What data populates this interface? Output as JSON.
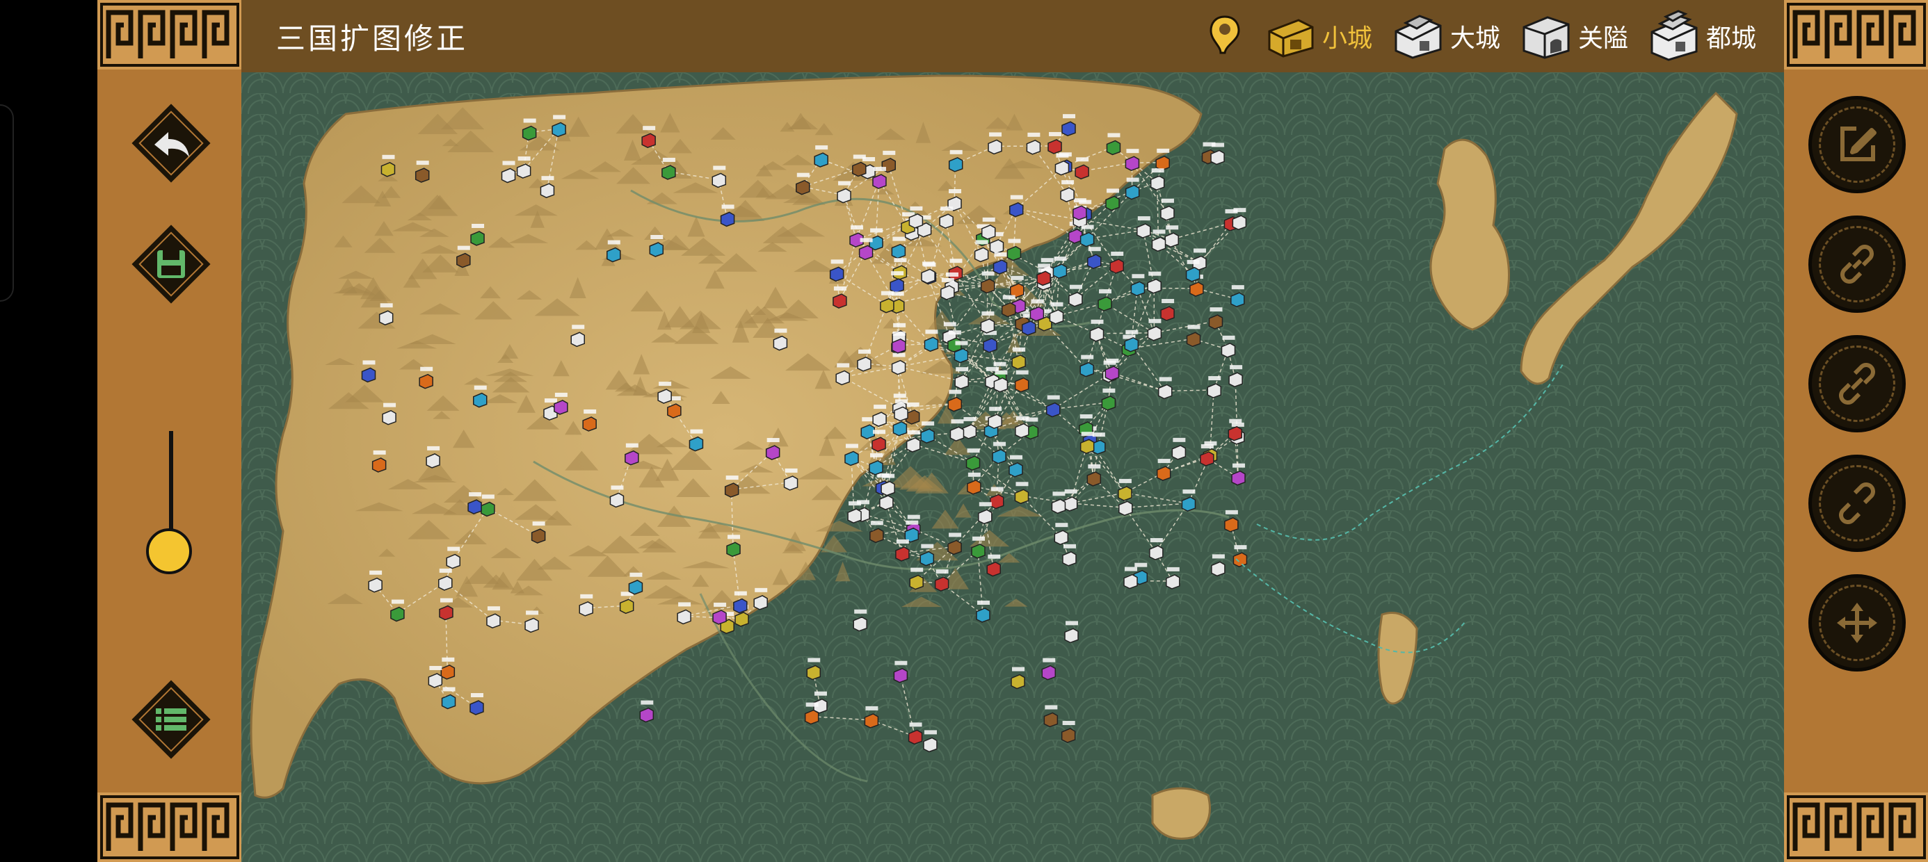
{
  "app": {
    "title": "三国扩图修正"
  },
  "legend": {
    "marker_icon": "map-pin-icon",
    "items": [
      {
        "label": "小城",
        "icon": "small-city-icon",
        "selected": true
      },
      {
        "label": "大城",
        "icon": "large-city-icon",
        "selected": false
      },
      {
        "label": "关隘",
        "icon": "pass-icon",
        "selected": false
      },
      {
        "label": "都城",
        "icon": "capital-icon",
        "selected": false
      }
    ]
  },
  "left_toolbar": {
    "buttons": [
      {
        "name": "back-button",
        "icon": "back-arrow-icon"
      },
      {
        "name": "save-button",
        "icon": "floppy-disk-icon"
      },
      {
        "name": "list-button",
        "icon": "list-icon"
      }
    ],
    "zoom_level": 0.15
  },
  "right_toolbar": {
    "buttons": [
      {
        "name": "edit-button",
        "icon": "edit-icon"
      },
      {
        "name": "link-button",
        "icon": "link-icon"
      },
      {
        "name": "link-alt-button",
        "icon": "link-alt-icon"
      },
      {
        "name": "unlink-button",
        "icon": "unlink-icon"
      },
      {
        "name": "move-button",
        "icon": "move-arrows-icon"
      }
    ]
  },
  "colors": {
    "sidebar": "#b27734",
    "topbar": "#6e4e22",
    "sea": "#3f5b4b",
    "land": "#c9a866",
    "accent": "#f0c13b"
  }
}
